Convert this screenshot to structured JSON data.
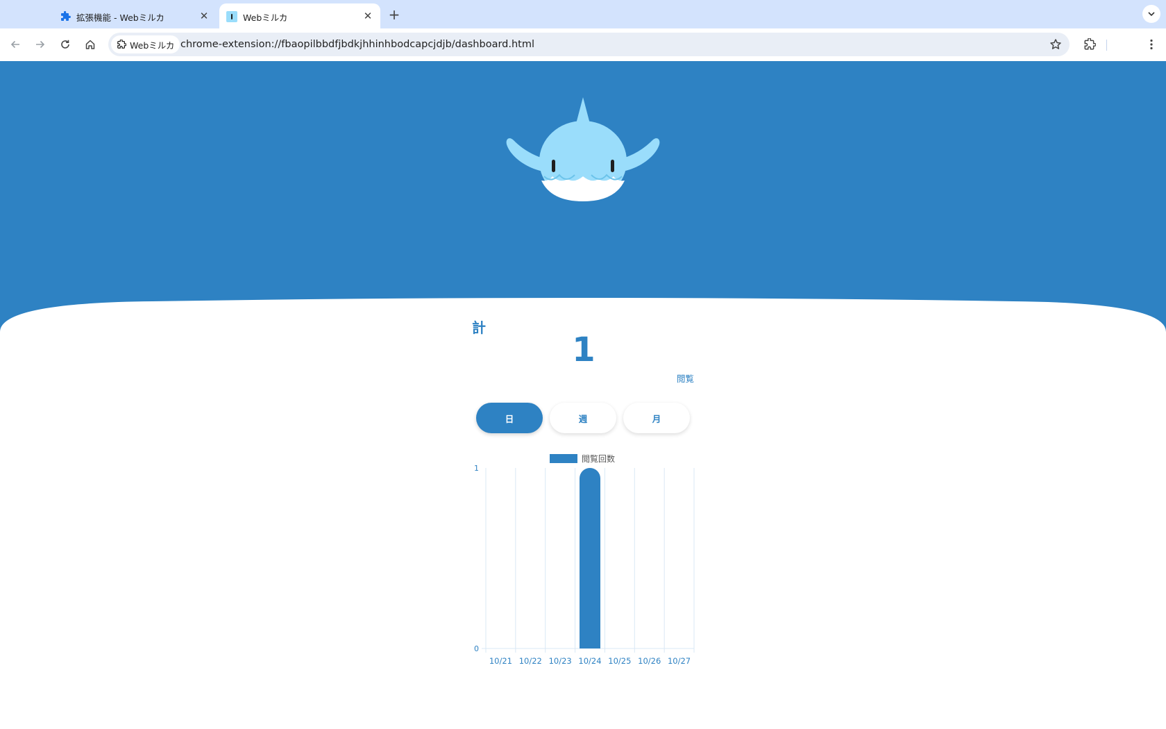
{
  "browser": {
    "tabs": [
      {
        "title": "拡張機能 - Webミルカ",
        "icon": "puzzle-icon",
        "active": false
      },
      {
        "title": "Webミルカ",
        "icon": "webmiruka-favicon",
        "active": true
      }
    ],
    "new_tab_label": "+",
    "site_chip_label": "Webミルカ",
    "url": "chrome-extension://fbaopilbbdfjbdkjhhinhbodcapcjdjb/dashboard.html"
  },
  "dashboard": {
    "total_label": "計",
    "total_value": "1",
    "total_unit": "閲覧",
    "periods": [
      {
        "label": "日",
        "active": true
      },
      {
        "label": "週",
        "active": false
      },
      {
        "label": "月",
        "active": false
      }
    ]
  },
  "colors": {
    "brand": "#2e82c3",
    "mascot": "#9addfb",
    "tab_strip": "#d3e3fd",
    "omnibox": "#e9eef6"
  },
  "chart_data": {
    "type": "bar",
    "categories": [
      "10/21",
      "10/22",
      "10/23",
      "10/24",
      "10/25",
      "10/26",
      "10/27"
    ],
    "series": [
      {
        "name": "閲覧回数",
        "values": [
          0,
          0,
          0,
          1,
          0,
          0,
          0
        ]
      }
    ],
    "ylim": [
      0,
      1
    ],
    "yticks": [
      "0",
      "1"
    ],
    "grid": true,
    "legend": "top-center",
    "color": "#2e82c3"
  }
}
